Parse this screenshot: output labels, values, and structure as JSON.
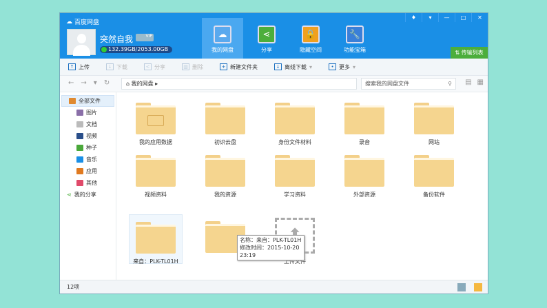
{
  "app": {
    "title": "百度网盘"
  },
  "user": {
    "name": "突然自我",
    "badge": "VIP",
    "quota": "132.39GB/2053.00GB"
  },
  "nav_tabs": [
    {
      "label": "我的网盘",
      "icon": "cloud-icon",
      "active": true
    },
    {
      "label": "分享",
      "icon": "share-icon"
    },
    {
      "label": "隐藏空间",
      "icon": "lock-icon"
    },
    {
      "label": "功能宝箱",
      "icon": "wrench-icon"
    }
  ],
  "transfer_list": "传输列表",
  "toolbar": [
    {
      "label": "上传",
      "icon": "upload-icon",
      "enabled": true
    },
    {
      "label": "下载",
      "icon": "download-icon",
      "enabled": false
    },
    {
      "label": "分享",
      "icon": "share-icon",
      "enabled": false
    },
    {
      "label": "删除",
      "icon": "trash-icon",
      "enabled": false
    },
    {
      "label": "新建文件夹",
      "icon": "new-folder-icon",
      "enabled": true
    },
    {
      "label": "离线下载",
      "icon": "offline-download-icon",
      "enabled": true
    },
    {
      "label": "更多",
      "icon": "more-icon",
      "enabled": true
    }
  ],
  "address": {
    "path": "我的网盘",
    "search_placeholder": "搜索我的网盘文件"
  },
  "sidebar": {
    "all_files": "全部文件",
    "items": [
      {
        "label": "图片",
        "color": "#8a6fa8"
      },
      {
        "label": "文档",
        "color": "#bbbbbb"
      },
      {
        "label": "视频",
        "color": "#2a4f8a"
      },
      {
        "label": "种子",
        "color": "#4aa83a"
      },
      {
        "label": "音乐",
        "color": "#1a8fe6"
      },
      {
        "label": "应用",
        "color": "#e07a20"
      },
      {
        "label": "其他",
        "color": "#e04a6a"
      }
    ],
    "my_share": "我的分享"
  },
  "files": [
    {
      "name": "我的应用数据",
      "locked": true
    },
    {
      "name": "初识云盘"
    },
    {
      "name": "身份文件材料"
    },
    {
      "name": "录音"
    },
    {
      "name": "网站"
    },
    {
      "name": "视频资料"
    },
    {
      "name": "我的资源"
    },
    {
      "name": "学习资料"
    },
    {
      "name": "外部资源"
    },
    {
      "name": "备份软件"
    },
    {
      "name": "来自：PLK-TL01H",
      "selected": true
    },
    {
      "name": ""
    }
  ],
  "upload_tile": "上传文件",
  "tooltip": {
    "line1": "名称：来自：PLK-TL01H",
    "line2": "修改时间：2015-10-20",
    "line3": "23:19"
  },
  "status": {
    "count": "12项"
  }
}
